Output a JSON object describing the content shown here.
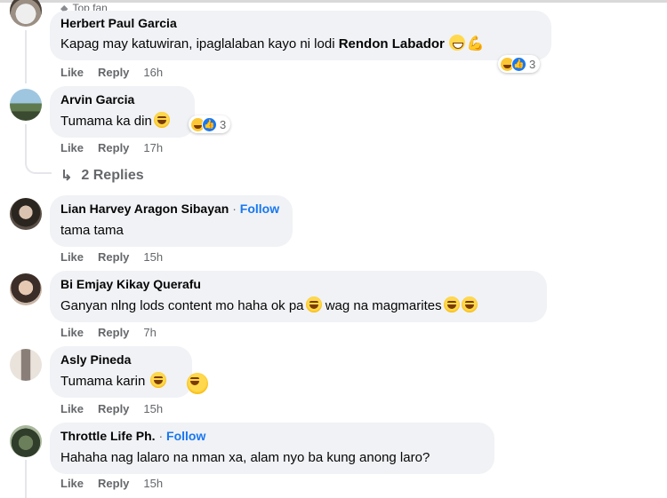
{
  "comments": [
    {
      "id": "c1",
      "badge": "Top fan",
      "author": "Herbert Paul Garcia",
      "text_prefix": "Kapag may katuwiran, ipaglalaban kayo ni lodi ",
      "text_bold": "Rendon Labador",
      "reaction_count": "3",
      "like": "Like",
      "reply": "Reply",
      "time": "16h"
    },
    {
      "id": "c2",
      "author": "Arvin Garcia",
      "text": "Tumama ka din",
      "reaction_count": "3",
      "like": "Like",
      "reply": "Reply",
      "time": "17h",
      "replies_label": "2 Replies"
    },
    {
      "id": "c3",
      "author": "Lian Harvey Aragon Sibayan",
      "follow_sep": "·",
      "follow": "Follow",
      "text": "tama tama",
      "like": "Like",
      "reply": "Reply",
      "time": "15h"
    },
    {
      "id": "c4",
      "author": "Bi Emjay Kikay Querafu",
      "text_a": "Ganyan nlng lods content mo haha ok pa",
      "text_b": " wag na magmarites",
      "like": "Like",
      "reply": "Reply",
      "time": "7h"
    },
    {
      "id": "c5",
      "author": "Asly Pineda",
      "text": "Tumama karin ",
      "like": "Like",
      "reply": "Reply",
      "time": "15h"
    },
    {
      "id": "c6",
      "author": "Throttle Life Ph.",
      "follow_sep": "·",
      "follow": "Follow",
      "text": "Hahaha nag lalaro na nman xa, alam nyo ba kung anong laro?",
      "like": "Like",
      "reply": "Reply",
      "time": "15h"
    }
  ],
  "colors": {
    "bubble": "#f0f2f5",
    "secondary_text": "#65676b",
    "link_blue": "#1877f2"
  }
}
